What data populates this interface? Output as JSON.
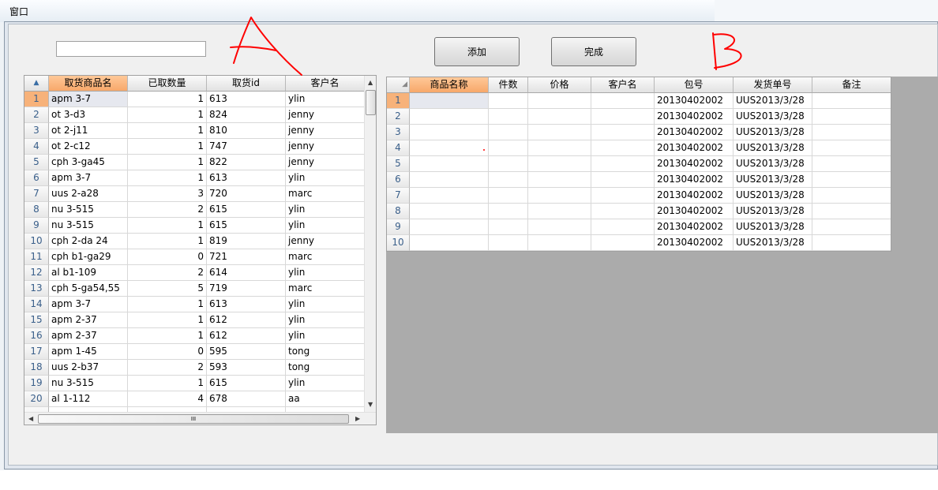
{
  "window": {
    "title": "窗口"
  },
  "controls": {
    "add_label": "添加",
    "done_label": "完成",
    "search_value": ""
  },
  "annotations": {
    "a": "A",
    "b": "B"
  },
  "colors": {
    "header_selected": "#f7a86a",
    "annotation": "#ff0000",
    "empty_area": "#ababab"
  },
  "icons": {
    "corner_left": "sort-icon",
    "corner_right": "triangle-icon"
  },
  "grid_a": {
    "columns": [
      "取货商品名",
      "已取数量",
      "取货id",
      "客户名"
    ],
    "rows": [
      {
        "no": "1",
        "name": "apm 3-7",
        "qty": "1",
        "id": "613",
        "cust": "ylin"
      },
      {
        "no": "2",
        "name": "ot 3-d3",
        "qty": "1",
        "id": "824",
        "cust": "jenny"
      },
      {
        "no": "3",
        "name": "ot 2-j11",
        "qty": "1",
        "id": "810",
        "cust": "jenny"
      },
      {
        "no": "4",
        "name": "ot 2-c12",
        "qty": "1",
        "id": "747",
        "cust": "jenny"
      },
      {
        "no": "5",
        "name": "cph 3-ga45",
        "qty": "1",
        "id": "822",
        "cust": "jenny"
      },
      {
        "no": "6",
        "name": "apm 3-7",
        "qty": "1",
        "id": "613",
        "cust": "ylin"
      },
      {
        "no": "7",
        "name": "uus 2-a28",
        "qty": "3",
        "id": "720",
        "cust": "marc"
      },
      {
        "no": "8",
        "name": "nu 3-515",
        "qty": "2",
        "id": "615",
        "cust": "ylin"
      },
      {
        "no": "9",
        "name": "nu 3-515",
        "qty": "1",
        "id": "615",
        "cust": "ylin"
      },
      {
        "no": "10",
        "name": "cph 2-da 24",
        "qty": "1",
        "id": "819",
        "cust": "jenny"
      },
      {
        "no": "11",
        "name": "cph b1-ga29",
        "qty": "0",
        "id": "721",
        "cust": "marc"
      },
      {
        "no": "12",
        "name": "al b1-109",
        "qty": "2",
        "id": "614",
        "cust": "ylin"
      },
      {
        "no": "13",
        "name": "cph 5-ga54,55",
        "qty": "5",
        "id": "719",
        "cust": "marc"
      },
      {
        "no": "14",
        "name": "apm 3-7",
        "qty": "1",
        "id": "613",
        "cust": "ylin"
      },
      {
        "no": "15",
        "name": "apm 2-37",
        "qty": "1",
        "id": "612",
        "cust": "ylin"
      },
      {
        "no": "16",
        "name": "apm 2-37",
        "qty": "1",
        "id": "612",
        "cust": "ylin"
      },
      {
        "no": "17",
        "name": "apm 1-45",
        "qty": "0",
        "id": "595",
        "cust": "tong"
      },
      {
        "no": "18",
        "name": "uus 2-b37",
        "qty": "2",
        "id": "593",
        "cust": "tong"
      },
      {
        "no": "19",
        "name": "nu 3-515",
        "qty": "1",
        "id": "615",
        "cust": "ylin"
      },
      {
        "no": "20",
        "name": "al 1-112",
        "qty": "4",
        "id": "678",
        "cust": "aa"
      }
    ],
    "hscroll_grip": "III"
  },
  "grid_b": {
    "columns": [
      "商品名称",
      "件数",
      "价格",
      "客户名",
      "包号",
      "发货单号",
      "备注"
    ],
    "rows": [
      {
        "no": "1",
        "pkg": "20130402002",
        "ship": "UUS2013/3/28"
      },
      {
        "no": "2",
        "pkg": "20130402002",
        "ship": "UUS2013/3/28"
      },
      {
        "no": "3",
        "pkg": "20130402002",
        "ship": "UUS2013/3/28"
      },
      {
        "no": "4",
        "pkg": "20130402002",
        "ship": "UUS2013/3/28"
      },
      {
        "no": "5",
        "pkg": "20130402002",
        "ship": "UUS2013/3/28"
      },
      {
        "no": "6",
        "pkg": "20130402002",
        "ship": "UUS2013/3/28"
      },
      {
        "no": "7",
        "pkg": "20130402002",
        "ship": "UUS2013/3/28"
      },
      {
        "no": "8",
        "pkg": "20130402002",
        "ship": "UUS2013/3/28"
      },
      {
        "no": "9",
        "pkg": "20130402002",
        "ship": "UUS2013/3/28"
      },
      {
        "no": "10",
        "pkg": "20130402002",
        "ship": "UUS2013/3/28"
      }
    ]
  }
}
